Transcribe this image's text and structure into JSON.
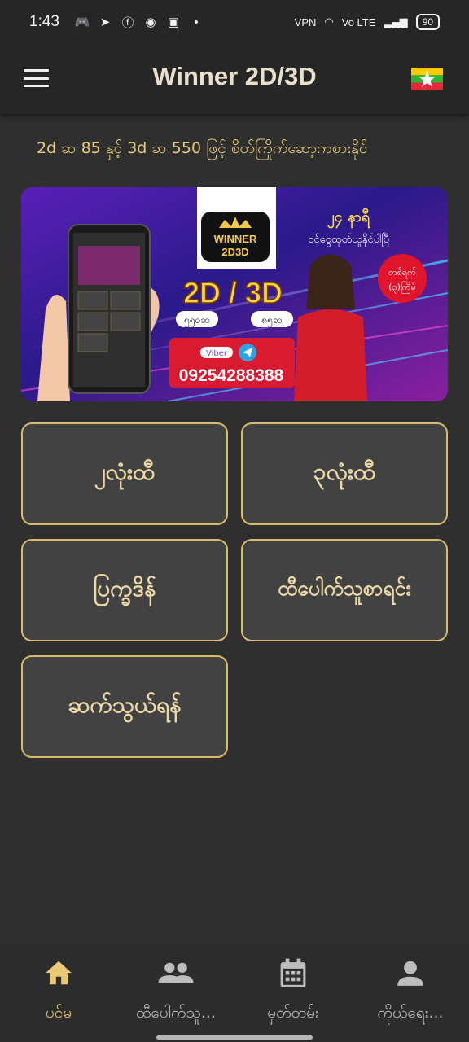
{
  "status_bar": {
    "time": "1:43",
    "notifications": [
      "discord-icon",
      "telegram-icon",
      "facebook-icon",
      "app-icon",
      "chat-icon"
    ],
    "vpn": "VPN",
    "network": "Vo LTE",
    "battery": "90"
  },
  "app_bar": {
    "title": "Winner 2D/3D",
    "flag": "myanmar-flag"
  },
  "marquee": {
    "text": "2d ဆ 85 နှင့် 3d ဆ 550 ဖြင့် စိတ်ကြိုက်ဆော့ကစားနိုင်"
  },
  "banner": {
    "logo_top": "WINNER",
    "logo_bottom": "2D3D",
    "headline": "2D / 3D",
    "rate_2d": "၈၅ဆ",
    "rate_3d": "၅၅၀ဆ",
    "promo_line1": "၂၄ နာရီ",
    "promo_line2": "ဝင်ငွေထုတ်ယူနိုင်ပါပြီ",
    "promo_badge_line1": "တစ်ရက်",
    "promo_badge_line2": "(၃)ကြိမ်",
    "viber": "Viber",
    "phone": "09254288388"
  },
  "menu": {
    "two_digit": "၂လုံးထီ",
    "three_digit": "၃လုံးထီ",
    "schedule": "ပြက္ခဒိန်",
    "winners_list": "ထီပေါက်သူစာရင်း",
    "contact": "ဆက်သွယ်ရန်"
  },
  "bottom_nav": [
    {
      "label": "ပင်မ",
      "icon": "home-icon",
      "active": true
    },
    {
      "label": "ထီပေါက်သူ...",
      "icon": "group-icon",
      "active": false
    },
    {
      "label": "မှတ်တမ်း",
      "icon": "calendar-icon",
      "active": false
    },
    {
      "label": "ကိုယ်ရေး...",
      "icon": "person-icon",
      "active": false
    }
  ],
  "colors": {
    "accent_gold": "#e9c978",
    "button_border": "#d9bb6c",
    "button_bg": "#424242",
    "background": "#2f2f2f"
  }
}
